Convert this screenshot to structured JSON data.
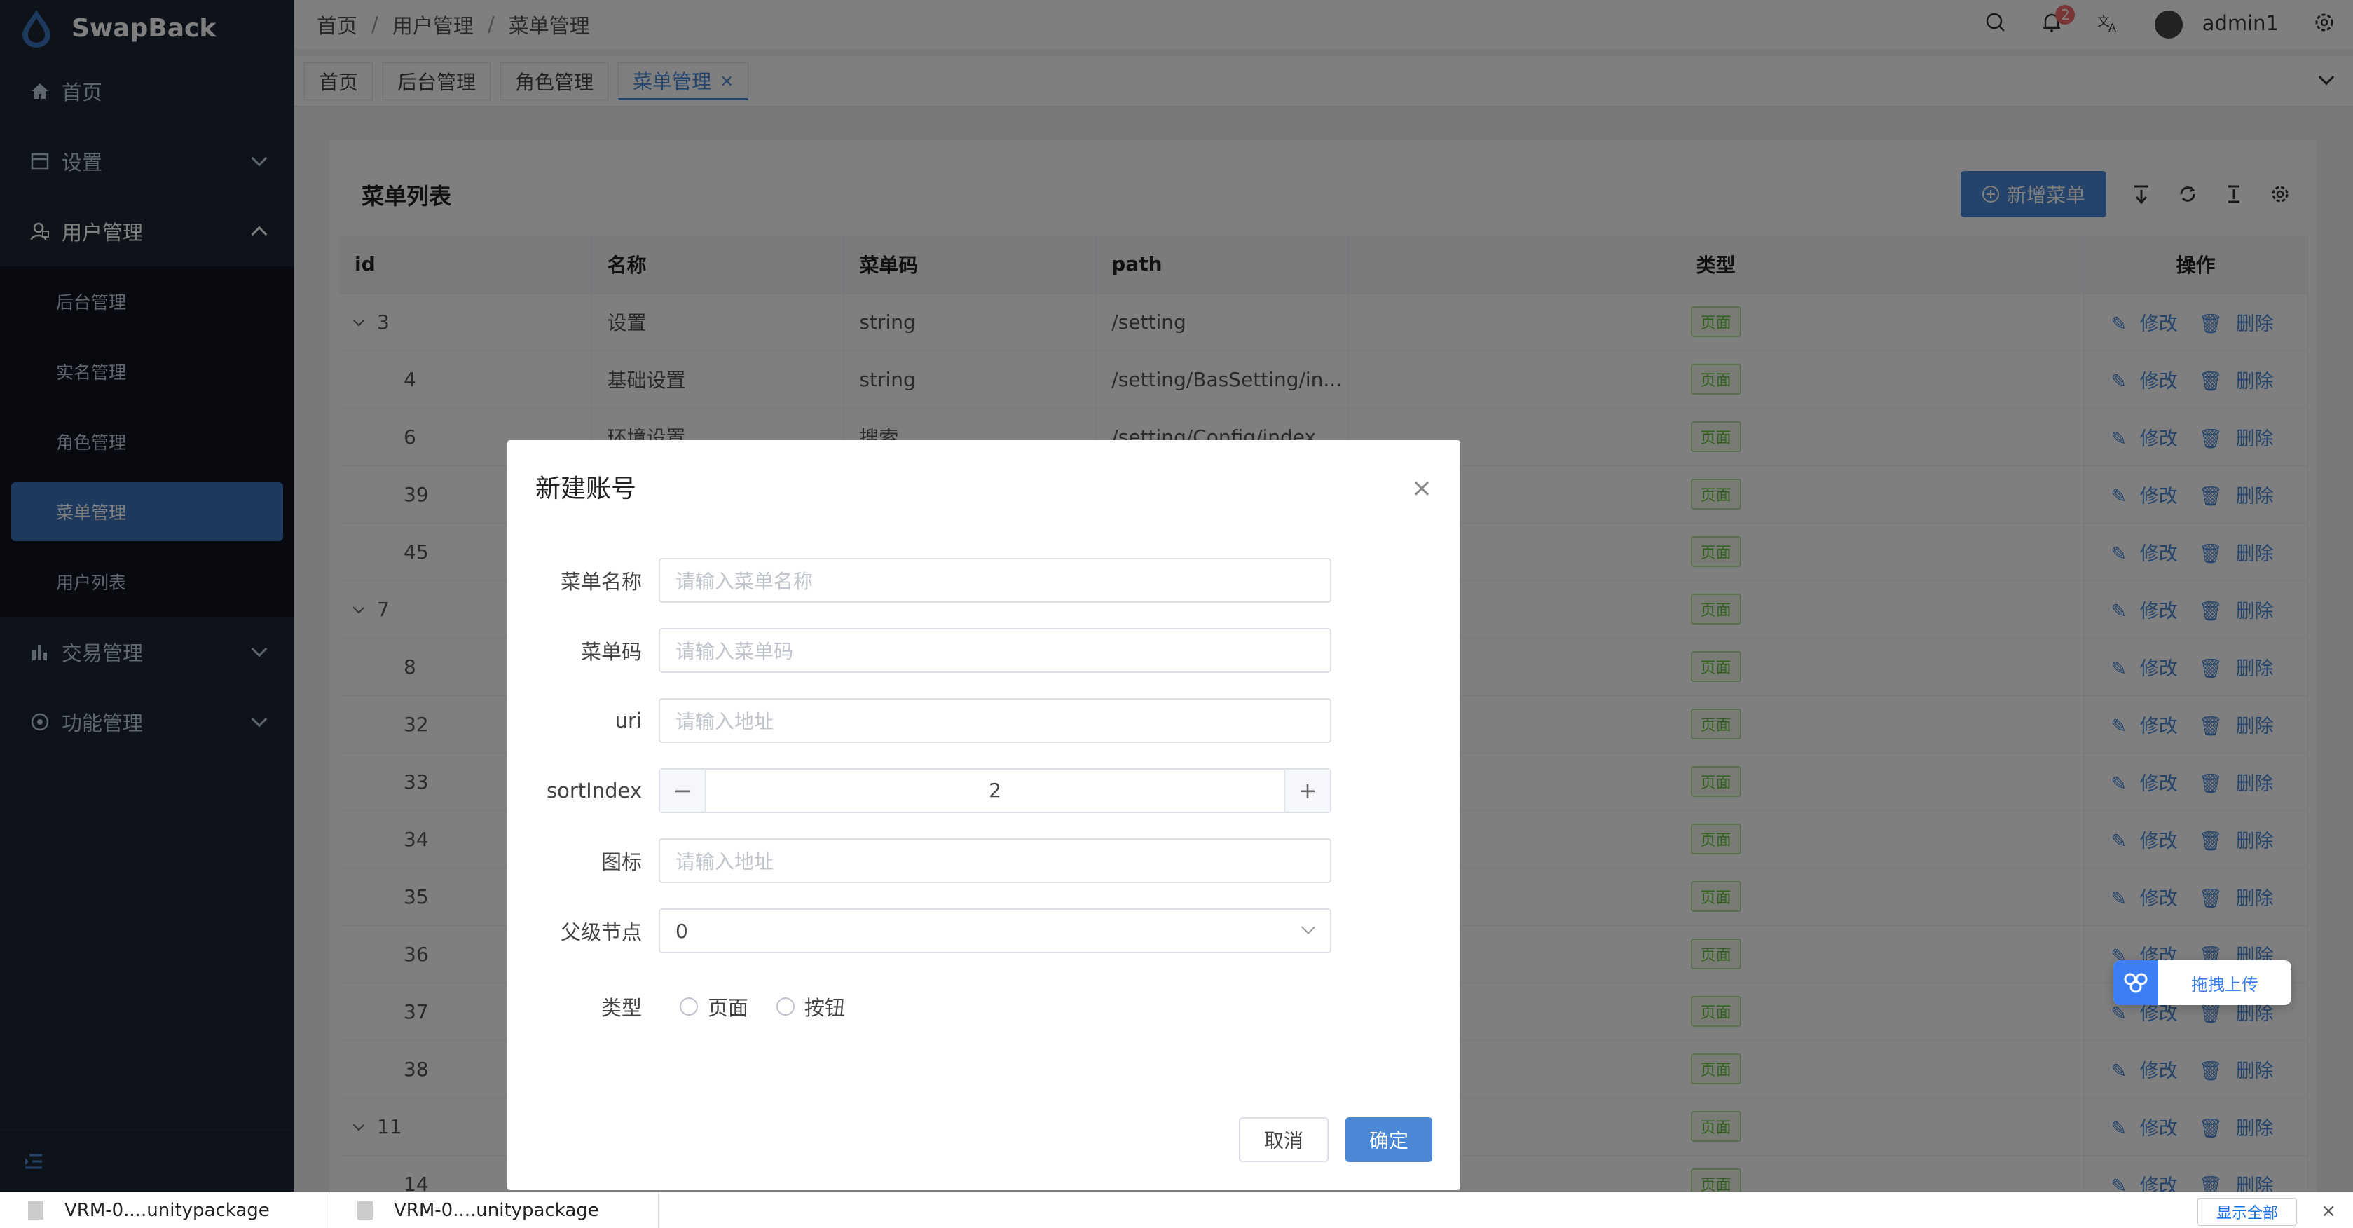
{
  "app": {
    "name": "SwapBack"
  },
  "sidebar": {
    "items": [
      {
        "label": "首页",
        "icon": "home-icon"
      },
      {
        "label": "设置",
        "icon": "settings-icon"
      },
      {
        "label": "用户管理",
        "icon": "users-icon"
      },
      {
        "label": "交易管理",
        "icon": "bar-chart-icon"
      },
      {
        "label": "功能管理",
        "icon": "function-icon"
      }
    ],
    "submenu": [
      "后台管理",
      "实名管理",
      "角色管理",
      "菜单管理",
      "用户列表"
    ]
  },
  "header": {
    "breadcrumb": [
      "首页",
      "用户管理",
      "菜单管理"
    ],
    "notifications": "2",
    "username": "admin1"
  },
  "tabs": [
    "首页",
    "后台管理",
    "角色管理",
    "菜单管理"
  ],
  "card": {
    "title": "菜单列表",
    "add_button": "新增菜单"
  },
  "table": {
    "columns": [
      "id",
      "名称",
      "菜单码",
      "path",
      "类型",
      "操作"
    ],
    "rows": [
      {
        "id": "3",
        "name": "设置",
        "code": "string",
        "path": "/setting",
        "type": "页面"
      },
      {
        "id": "4",
        "name": "基础设置",
        "code": "string",
        "path": "/setting/BasSetting/in...",
        "type": "页面"
      },
      {
        "id": "6",
        "name": "环境设置",
        "code": "搜索",
        "path": "/setting/Config/index",
        "type": "页面"
      },
      {
        "id": "39",
        "name": "",
        "code": "",
        "path": "",
        "type": "页面"
      },
      {
        "id": "45",
        "name": "",
        "code": "",
        "path": "",
        "type": "页面"
      },
      {
        "id": "7",
        "name": "",
        "code": "",
        "path": "",
        "type": "页面"
      },
      {
        "id": "8",
        "name": "",
        "code": "",
        "path": "",
        "type": "页面"
      },
      {
        "id": "32",
        "name": "",
        "code": "",
        "path": "",
        "type": "页面"
      },
      {
        "id": "33",
        "name": "",
        "code": "",
        "path": "",
        "type": "页面"
      },
      {
        "id": "34",
        "name": "",
        "code": "",
        "path": "",
        "type": "页面"
      },
      {
        "id": "35",
        "name": "",
        "code": "",
        "path": "",
        "type": "页面"
      },
      {
        "id": "36",
        "name": "",
        "code": "",
        "path": "",
        "type": "页面"
      },
      {
        "id": "37",
        "name": "",
        "code": "",
        "path": "",
        "type": "页面"
      },
      {
        "id": "38",
        "name": "",
        "code": "",
        "path": "",
        "type": "页面"
      },
      {
        "id": "11",
        "name": "",
        "code": "",
        "path": "",
        "type": "页面"
      },
      {
        "id": "14",
        "name": "",
        "code": "",
        "path": "",
        "type": "页面"
      }
    ],
    "edit_label": "修改",
    "delete_label": "删除"
  },
  "dialog": {
    "title": "新建账号",
    "fields": {
      "name_label": "菜单名称",
      "name_placeholder": "请输入菜单名称",
      "code_label": "菜单码",
      "code_placeholder": "请输入菜单码",
      "uri_label": "uri",
      "uri_placeholder": "请输入地址",
      "sort_label": "sortIndex",
      "sort_value": "2",
      "icon_label": "图标",
      "icon_placeholder": "请输入地址",
      "parent_label": "父级节点",
      "parent_value": "0",
      "type_label": "类型",
      "type_option1": "页面",
      "type_option2": "按钮"
    },
    "cancel": "取消",
    "confirm": "确定"
  },
  "upload_float": {
    "label": "拖拽上传"
  },
  "downloads": {
    "items": [
      "VRM-0....unitypackage",
      "VRM-0....unitypackage"
    ],
    "show_all": "显示全部"
  }
}
